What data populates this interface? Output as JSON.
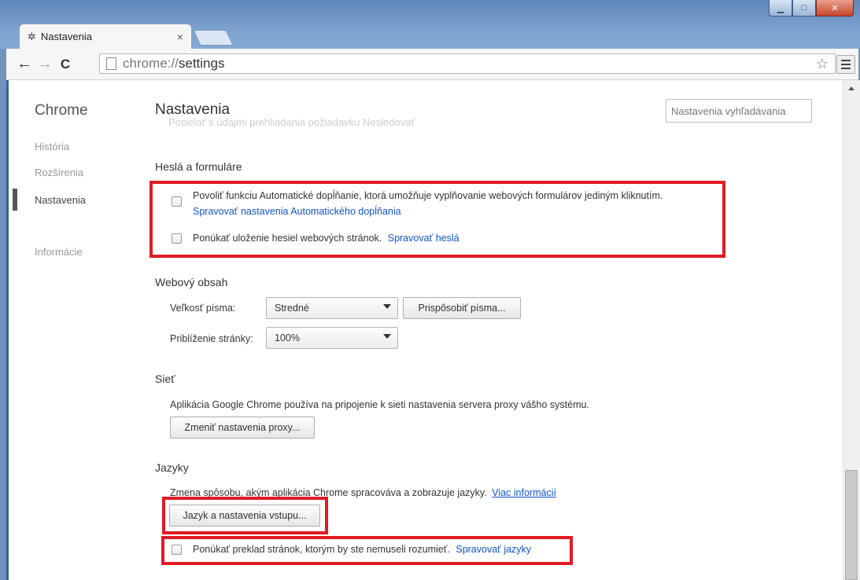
{
  "window": {
    "min_glyph": "▁",
    "max_glyph": "□",
    "close_glyph": "✕"
  },
  "tab": {
    "title": "Nastavenia",
    "close_glyph": "×"
  },
  "toolbar": {
    "back_glyph": "←",
    "forward_glyph": "→",
    "reload_glyph": "C",
    "url_scheme": "chrome://",
    "url_path": "settings",
    "star_glyph": "☆"
  },
  "sidebar": {
    "brand": "Chrome",
    "items": [
      {
        "label": "História"
      },
      {
        "label": "Rozšírenia"
      },
      {
        "label": "Nastavenia"
      },
      {
        "label": "Informácie"
      }
    ]
  },
  "header": {
    "title": "Nastavenia",
    "search_placeholder": "Nastavenia vyhľadávania",
    "ghost_text": "Posielať s údajmi prehliadania požiadavku Nesledovať"
  },
  "passwords": {
    "title": "Heslá a formuláre",
    "autofill_label": "Povoliť funkciu Automatické dopĺňanie, ktorá umožňuje vyplňovanie webových formulárov jediným kliknutím.",
    "autofill_link": "Spravovať nastavenia Automatického dopĺňania",
    "save_passwords_label": "Ponúkať uloženie hesiel webových stránok.",
    "save_passwords_link": "Spravovať heslá"
  },
  "web_content": {
    "title": "Webový obsah",
    "font_size_label": "Veľkosť písma:",
    "font_size_value": "Stredné",
    "customize_fonts_button": "Prispôsobiť písma...",
    "zoom_label": "Priblíženie stránky:",
    "zoom_value": "100%"
  },
  "network": {
    "title": "Sieť",
    "description": "Aplikácia Google Chrome používa na pripojenie k sieti nastavenia servera proxy vášho systému.",
    "proxy_button": "Zmeniť nastavenia proxy..."
  },
  "languages": {
    "title": "Jazyky",
    "description": "Zmena spôsobu, akým aplikácia Chrome spracováva a zobrazuje jazyky.",
    "more_info_link": "Viac informácií",
    "language_button": "Jazyk a nastavenia vstupu...",
    "translate_label": "Ponúkať preklad stránok, ktorým by ste nemuseli rozumieť.",
    "translate_link": "Spravovať jazyky"
  },
  "colors": {
    "highlight": "#e01b24",
    "link": "#1155cc"
  }
}
